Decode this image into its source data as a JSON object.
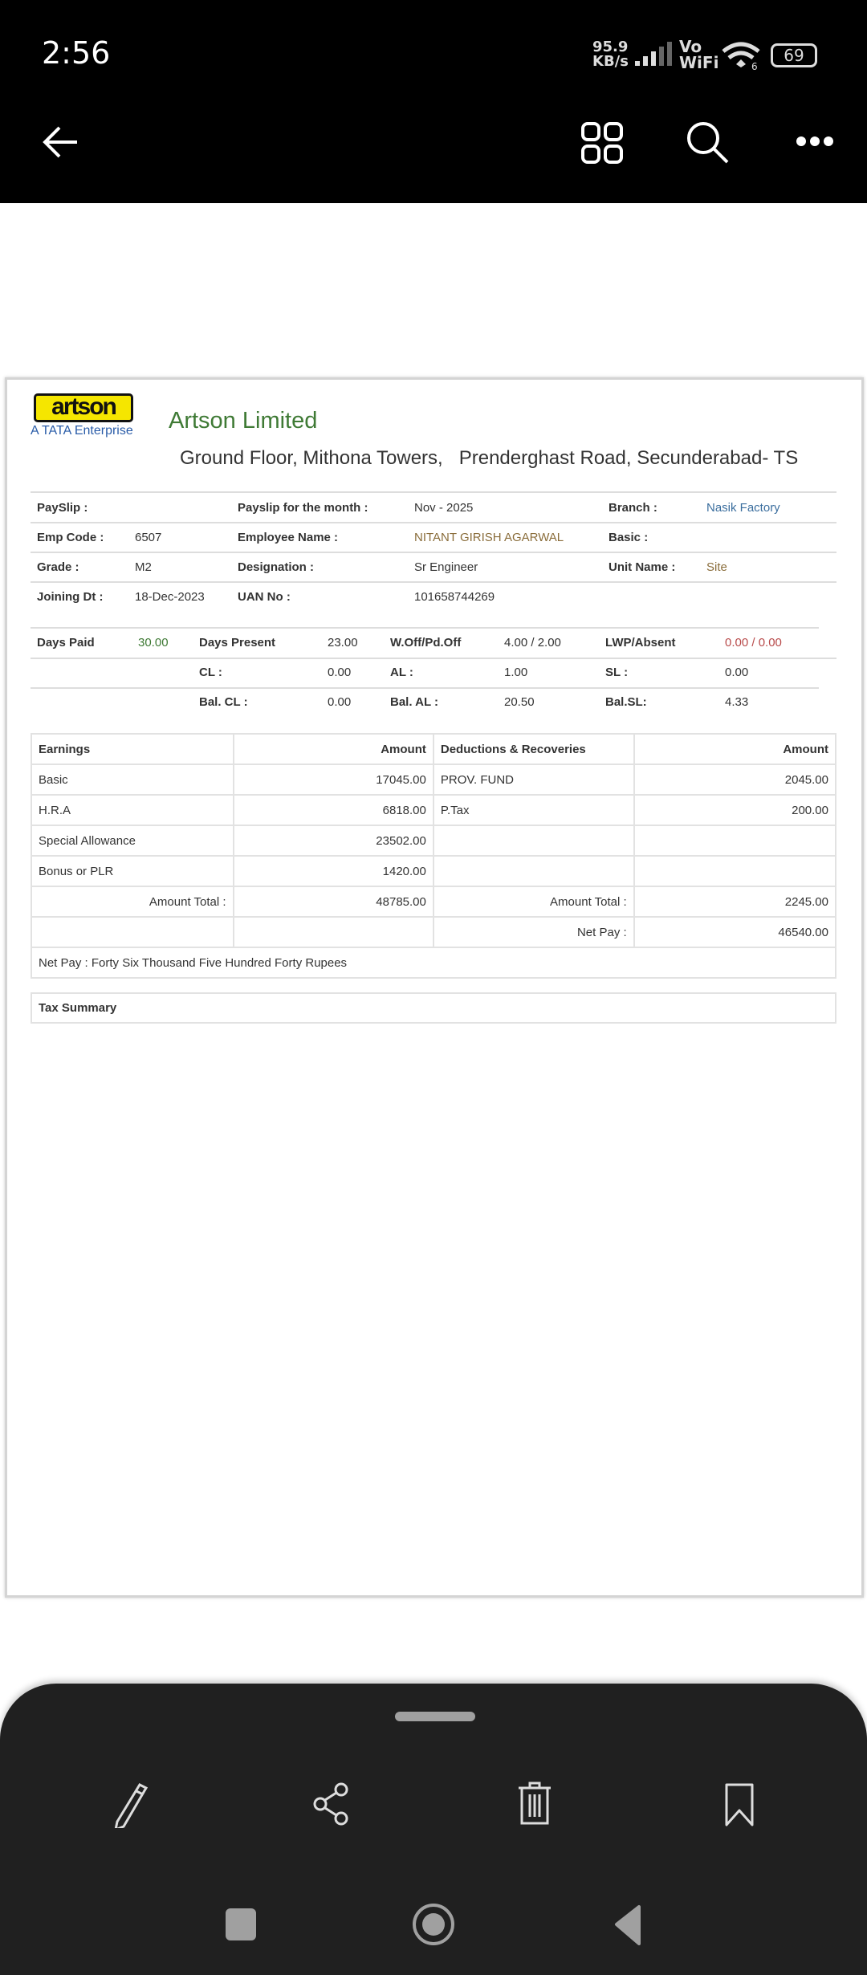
{
  "status_bar": {
    "time": "2:56",
    "net_speed": "95.9",
    "net_unit": "KB/s",
    "vowifi_top": "Vo",
    "vowifi_bottom": "WiFi",
    "wifi_gen": "6",
    "battery": "69"
  },
  "toolbar": {
    "icons": [
      "back-arrow-icon",
      "grid-icon",
      "search-icon",
      "more-icon"
    ]
  },
  "company": {
    "logo_text": "artson",
    "tagline": "A TATA Enterprise",
    "name": "Artson Limited",
    "address": "Ground Floor, Mithona Towers,   Prenderghast Road, Secunderabad- TS"
  },
  "info": {
    "payslip_label": "PaySlip :",
    "month_label": "Payslip for the month :",
    "month": "Nov - 2025",
    "branch_label": "Branch :",
    "branch": "Nasik Factory",
    "emp_code_label": "Emp Code :",
    "emp_code": "6507",
    "emp_name_label": "Employee Name :",
    "emp_name": "NITANT GIRISH AGARWAL",
    "basic_label": "Basic :",
    "grade_label": "Grade :",
    "grade": "M2",
    "designation_label": "Designation :",
    "designation": "Sr Engineer",
    "unit_label": "Unit Name :",
    "unit": "Site",
    "joining_label": "Joining Dt :",
    "joining": "18-Dec-2023",
    "uan_label": "UAN No :",
    "uan": "101658744269"
  },
  "attendance": {
    "days_paid_label": "Days Paid",
    "days_paid": "30.00",
    "days_present_label": "Days Present",
    "days_present": "23.00",
    "woff_label": "W.Off/Pd.Off",
    "woff": "4.00 / 2.00",
    "lwp_label": "LWP/Absent",
    "lwp": "0.00 / 0.00",
    "cl_label": "CL :",
    "cl": "0.00",
    "al_label": "AL :",
    "al": "1.00",
    "sl_label": "SL :",
    "sl": "0.00",
    "bal_cl_label": "Bal. CL :",
    "bal_cl": "0.00",
    "bal_al_label": "Bal. AL :",
    "bal_al": "20.50",
    "bal_sl_label": "Bal.SL:",
    "bal_sl": "4.33"
  },
  "earnings": {
    "headers": [
      "Earnings",
      "Amount",
      "Deductions & Recoveries",
      "Amount"
    ],
    "rows": [
      [
        "Basic",
        "17045.00",
        "PROV. FUND",
        "2045.00"
      ],
      [
        "H.R.A",
        "6818.00",
        "P.Tax",
        "200.00"
      ],
      [
        "Special Allowance",
        "23502.00",
        "",
        ""
      ],
      [
        "Bonus or PLR",
        "1420.00",
        "",
        ""
      ]
    ],
    "total_label": "Amount Total :",
    "earn_total": "48785.00",
    "ded_total": "2245.00",
    "net_pay_label": "Net Pay :",
    "net_pay": "46540.00",
    "net_pay_words": "Net Pay : Forty Six Thousand Five Hundred Forty Rupees"
  },
  "tax_summary": "Tax Summary",
  "colors": {
    "green": "#3f7a35",
    "blue": "#3b6e9e",
    "brown": "#8a6d3b",
    "red": "#b84a4a"
  }
}
